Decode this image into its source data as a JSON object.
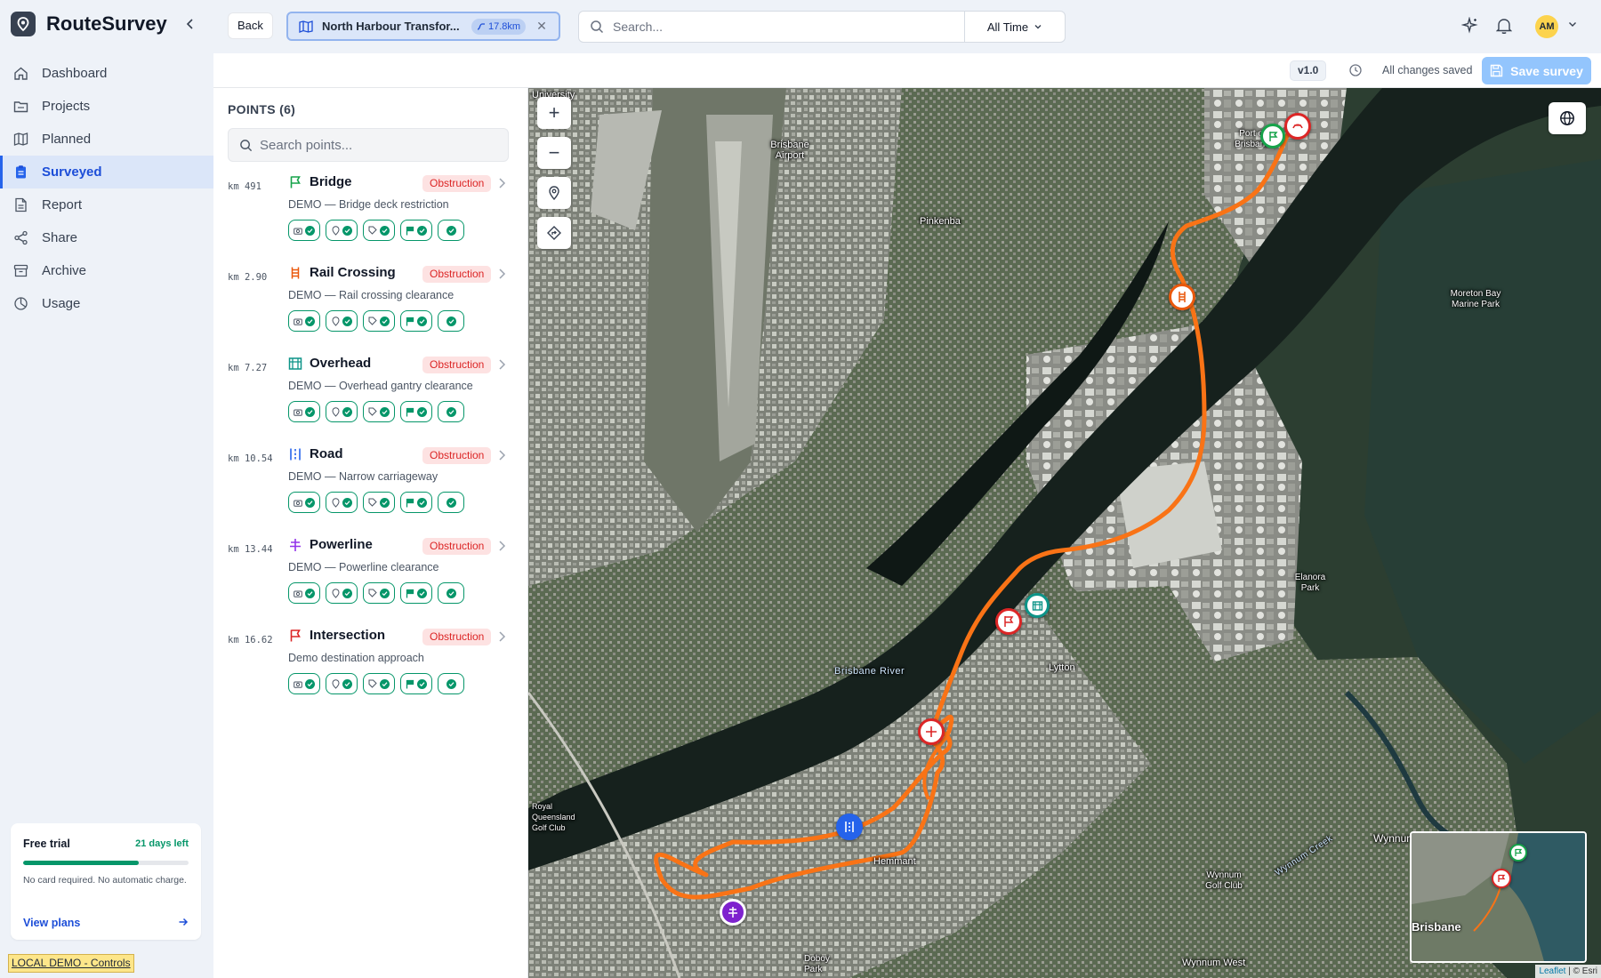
{
  "app": {
    "name": "RouteSurvey"
  },
  "sidebar": {
    "items": [
      {
        "label": "Dashboard",
        "icon": "home-icon",
        "active": false
      },
      {
        "label": "Projects",
        "icon": "folder-icon",
        "active": false
      },
      {
        "label": "Planned",
        "icon": "map-icon",
        "active": false
      },
      {
        "label": "Surveyed",
        "icon": "clipboard-icon",
        "active": true
      },
      {
        "label": "Report",
        "icon": "document-icon",
        "active": false
      },
      {
        "label": "Share",
        "icon": "share-icon",
        "active": false
      },
      {
        "label": "Archive",
        "icon": "archive-icon",
        "active": false
      },
      {
        "label": "Usage",
        "icon": "usage-icon",
        "active": false
      }
    ],
    "trial": {
      "title": "Free trial",
      "days_left": "21 days left",
      "progress": 0.7,
      "note": "No card required. No automatic charge.",
      "link": "View plans"
    },
    "demo_badge": "LOCAL DEMO - Controls"
  },
  "topbar": {
    "back_label": "Back",
    "route_title": "North Harbour Transfor...",
    "route_distance": "17.8km",
    "search_placeholder": "Search...",
    "time_filter": "All Time",
    "avatar_initials": "AM"
  },
  "subbar": {
    "version": "v1.0",
    "status": "All changes saved",
    "save_label": "Save survey"
  },
  "points_panel": {
    "title": "POINTS (6)",
    "search_placeholder": "Search points...",
    "points": [
      {
        "km": "km 491",
        "name": "Bridge",
        "tag": "Obstruction",
        "desc": "DEMO — Bridge deck restriction",
        "icon": "flag-icon",
        "icon_color": "#16a34a"
      },
      {
        "km": "km 2.90",
        "name": "Rail Crossing",
        "tag": "Obstruction",
        "desc": "DEMO — Rail crossing clearance",
        "icon": "rail-icon",
        "icon_color": "#ea580c"
      },
      {
        "km": "km 7.27",
        "name": "Overhead",
        "tag": "Obstruction",
        "desc": "DEMO — Overhead gantry clearance",
        "icon": "gantry-icon",
        "icon_color": "#0d9488"
      },
      {
        "km": "km 10.54",
        "name": "Road",
        "tag": "Obstruction",
        "desc": "DEMO — Narrow carriageway",
        "icon": "road-icon",
        "icon_color": "#2563eb"
      },
      {
        "km": "km 13.44",
        "name": "Powerline",
        "tag": "Obstruction",
        "desc": "DEMO — Powerline clearance",
        "icon": "powerline-icon",
        "icon_color": "#9333ea"
      },
      {
        "km": "km 16.62",
        "name": "Intersection",
        "tag": "Obstruction",
        "desc": "Demo destination approach",
        "icon": "flag-icon",
        "icon_color": "#dc2626"
      }
    ],
    "check_badges": [
      "camera-icon",
      "location-icon",
      "tag-icon",
      "flag-icon",
      "check-icon"
    ]
  },
  "map": {
    "labels": [
      "University",
      "Brisbane Airport",
      "Pinkenba",
      "Port of Brisbane",
      "Moreton Bay Marine Park",
      "Elanora Park",
      "Lytton",
      "Brisbane River",
      "Royal Queensland Golf Club",
      "Hemmant",
      "Doboy Park",
      "Wynnum Golf Club",
      "Wynnum Creek",
      "Wynnum",
      "Wynnum West"
    ],
    "minimap_label": "Brisbane",
    "attribution": {
      "leaflet": "Leaflet",
      "rest": " | © Esri"
    },
    "route_color": "#f97316"
  }
}
